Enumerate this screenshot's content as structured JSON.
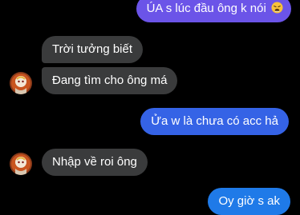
{
  "conversation": {
    "messages": [
      {
        "side": "out",
        "text": "ÚA s lúc đầu ông k nói",
        "emoji": "tired-face-emoji"
      },
      {
        "side": "in",
        "text": "Trời tưởng biết"
      },
      {
        "side": "in",
        "text": "Đang tìm cho ông má"
      },
      {
        "side": "out",
        "text": "Ửa w là chưa có acc hả"
      },
      {
        "side": "in",
        "text": "Nhập về roi ông"
      },
      {
        "side": "out",
        "text": "Oy giờ s ak"
      }
    ]
  },
  "colors": {
    "outgoing_top": "#6b54e8",
    "outgoing_mid": "#3563e6",
    "outgoing_bottom": "#1f7ae8",
    "incoming": "#3a3b3c",
    "background": "#000000"
  }
}
